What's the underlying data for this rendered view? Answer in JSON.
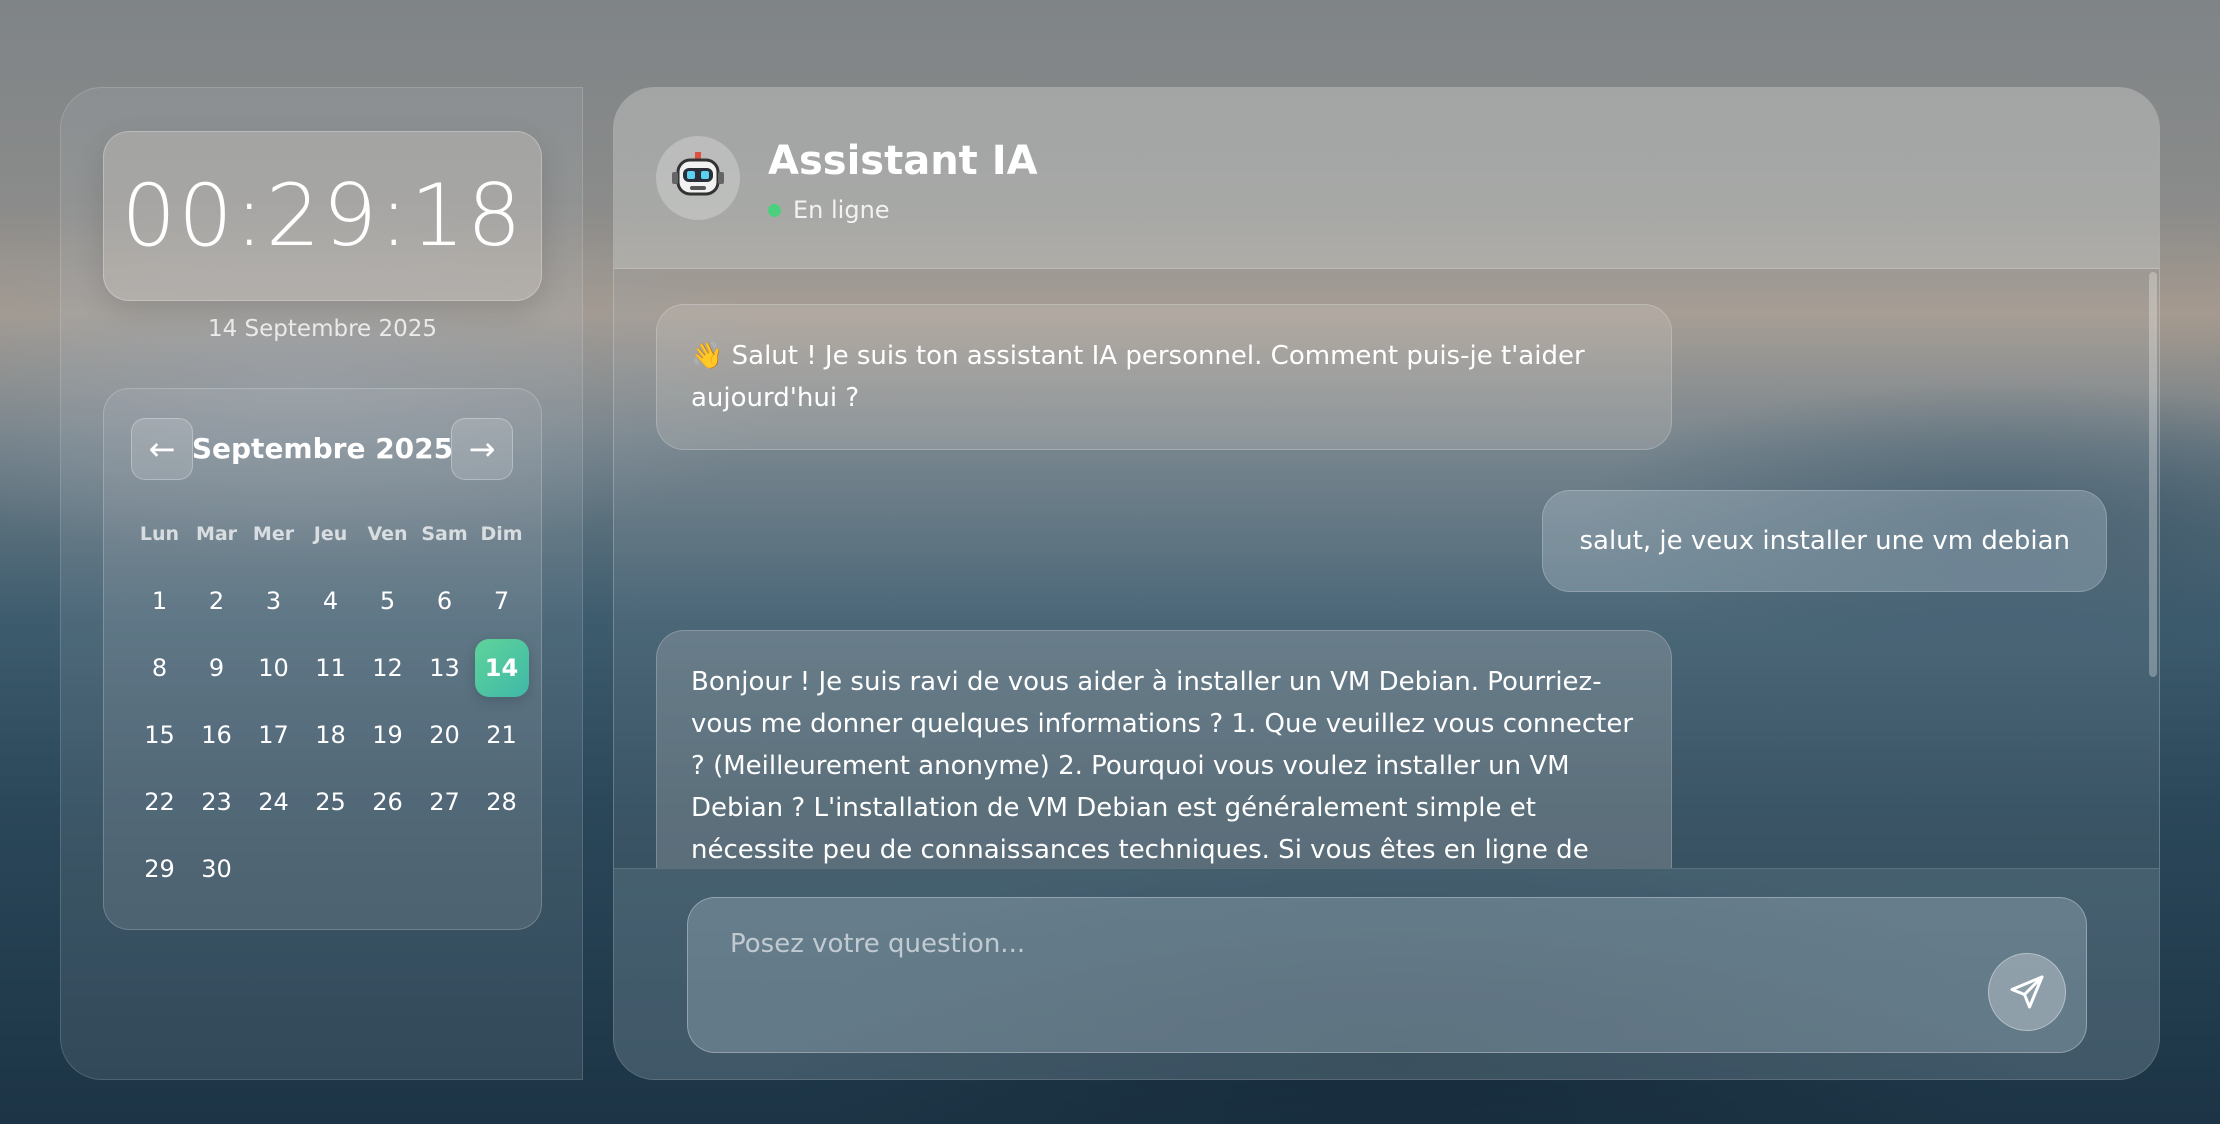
{
  "clock": {
    "time": "00:29:18",
    "date": "14 Septembre 2025"
  },
  "calendar": {
    "month_title": "Septembre 2025",
    "prev_label": "←",
    "next_label": "→",
    "weekdays": [
      "Lun",
      "Mar",
      "Mer",
      "Jeu",
      "Ven",
      "Sam",
      "Dim"
    ],
    "days": [
      "1",
      "2",
      "3",
      "4",
      "5",
      "6",
      "7",
      "8",
      "9",
      "10",
      "11",
      "12",
      "13",
      "14",
      "15",
      "16",
      "17",
      "18",
      "19",
      "20",
      "21",
      "22",
      "23",
      "24",
      "25",
      "26",
      "27",
      "28",
      "29",
      "30"
    ],
    "today": "14"
  },
  "chat": {
    "title": "Assistant IA",
    "status": "En ligne",
    "avatar_icon": "robot-icon",
    "messages": [
      {
        "role": "bot",
        "text": "👋 Salut ! Je suis ton assistant IA personnel. Comment puis-je t'aider aujourd'hui ?"
      },
      {
        "role": "user",
        "text": "salut, je veux installer une vm debian"
      },
      {
        "role": "bot",
        "text": "Bonjour ! Je suis ravi de vous aider à installer un VM Debian. Pourriez-vous me donner quelques informations ? 1. Que veuillez vous connecter ? (Meilleurement anonyme) 2. Pourquoi vous voulez installer un VM Debian ? L'installation de VM Debian est généralement simple et nécessite peu de connaissances techniques. Si vous êtes en ligne de bureau, je peux vous"
      }
    ],
    "input_placeholder": "Posez votre question...",
    "send_icon": "send-icon"
  },
  "colors": {
    "today_accent": "#4cc8a0",
    "online": "#4cd07d"
  }
}
